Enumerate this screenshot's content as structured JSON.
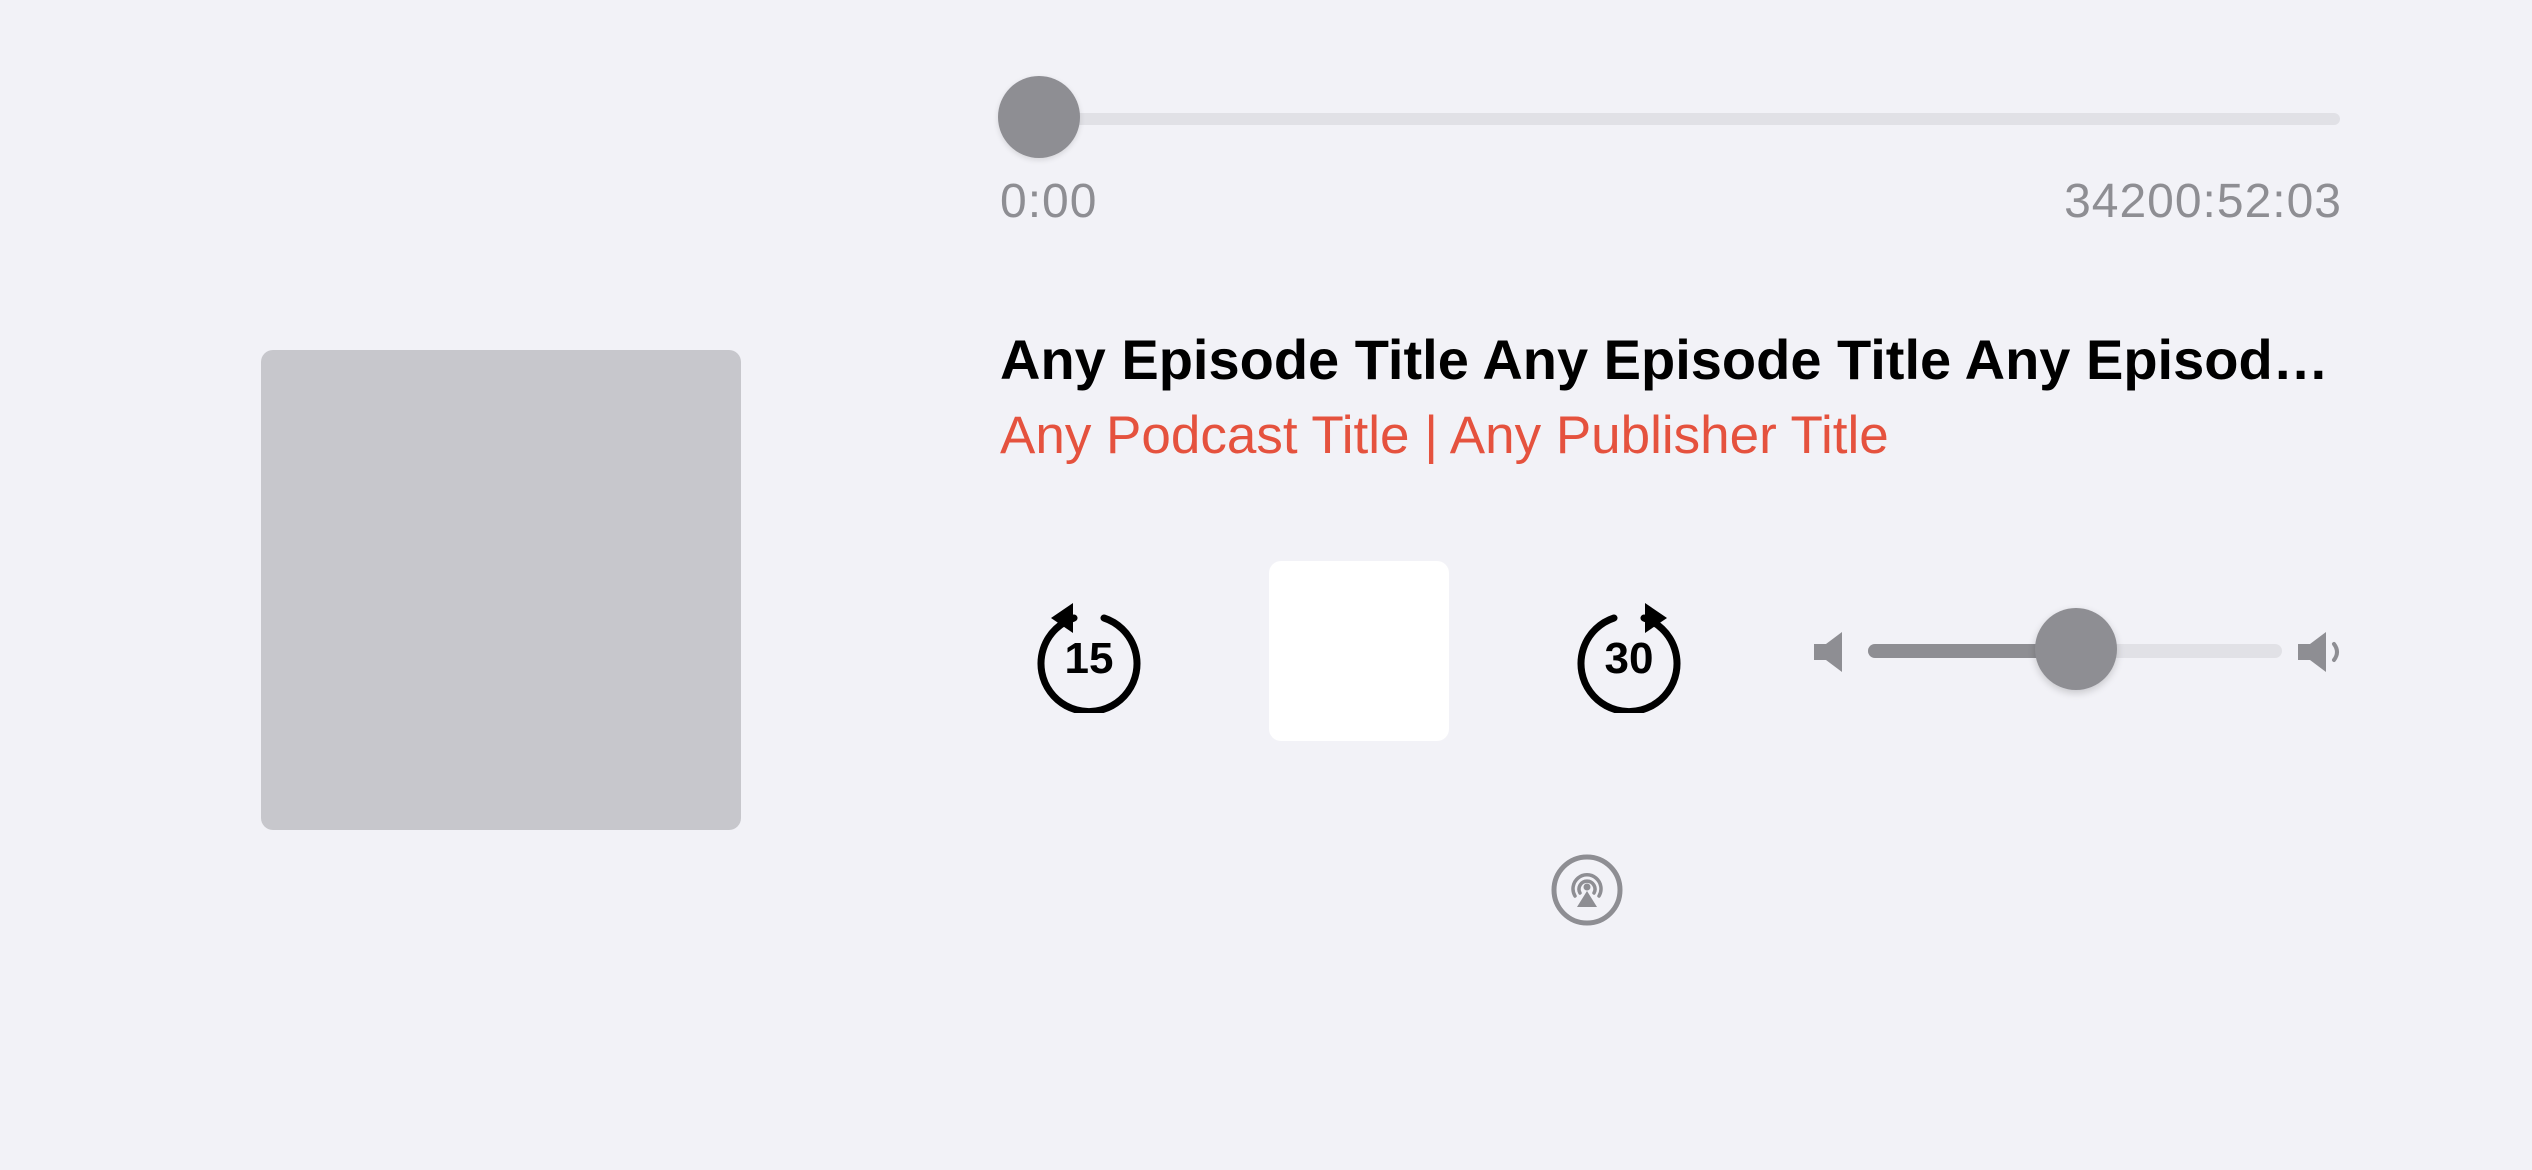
{
  "playback": {
    "elapsed": "0:00",
    "remaining": "34200:52:03",
    "progress_fraction": 0.0
  },
  "episode": {
    "title": "Any Episode Title Any Episode Title Any Episode Title Any Episode Title",
    "subtitle": "Any Podcast Title | Any Publisher Title"
  },
  "controls": {
    "skip_back_seconds": "15",
    "skip_forward_seconds": "30"
  },
  "volume": {
    "level_fraction": 0.43
  },
  "colors": {
    "background": "#f2f2f7",
    "accent": "#e5523e",
    "control_gray": "#8e8e93",
    "track_gray": "#e1e1e6",
    "artwork_placeholder": "#c7c7cc"
  },
  "icons": {
    "skip_back": "gobackward-15-icon",
    "skip_forward": "goforward-30-icon",
    "volume_min": "speaker-low-icon",
    "volume_max": "speaker-high-icon",
    "airplay": "airplay-audio-icon"
  }
}
